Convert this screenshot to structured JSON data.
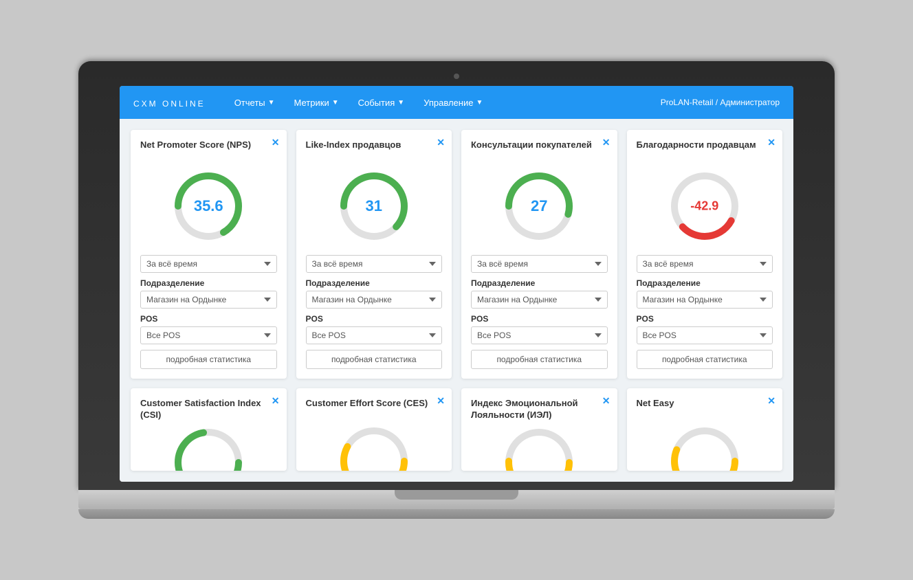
{
  "laptop": {
    "camera_label": "camera"
  },
  "navbar": {
    "brand": "CXM ONLINE",
    "menu_items": [
      {
        "label": "Отчеты",
        "has_arrow": true
      },
      {
        "label": "Метрики",
        "has_arrow": true
      },
      {
        "label": "События",
        "has_arrow": true
      },
      {
        "label": "Управление",
        "has_arrow": true
      }
    ],
    "user": "ProLAN-Retail / Администратор"
  },
  "cards": [
    {
      "title": "Net Promoter Score (NPS)",
      "value": "35.6",
      "value_type": "positive",
      "gauge_color": "#4CAF50",
      "gauge_pct": 68,
      "time_label": "За всё время",
      "dept_label": "Подразделение",
      "dept_value": "Магазин на Ордынке",
      "pos_label": "POS",
      "pos_value": "Все POS",
      "btn_label": "подробная статистика"
    },
    {
      "title": "Like-Index продавцов",
      "value": "31",
      "value_type": "positive",
      "gauge_color": "#4CAF50",
      "gauge_pct": 62,
      "time_label": "За всё время",
      "dept_label": "Подразделение",
      "dept_value": "Магазин на Ордынке",
      "pos_label": "POS",
      "pos_value": "Все POS",
      "btn_label": "подробная статистика"
    },
    {
      "title": "Консультации покупателей",
      "value": "27",
      "value_type": "positive",
      "gauge_color": "#4CAF50",
      "gauge_pct": 54,
      "time_label": "За всё время",
      "dept_label": "Подразделение",
      "dept_value": "Магазин на Ордынке",
      "pos_label": "POS",
      "pos_value": "Все POS",
      "btn_label": "подробная статистика"
    },
    {
      "title": "Благодарности продавцам",
      "value": "-42.9",
      "value_type": "negative",
      "gauge_color": "#e53935",
      "gauge_pct": 30,
      "time_label": "За всё время",
      "dept_label": "Подразделение",
      "dept_value": "Магазин на Ордынке",
      "pos_label": "POS",
      "pos_value": "Все POS",
      "btn_label": "подробная статистика"
    }
  ],
  "bottom_cards": [
    {
      "title": "Customer Satisfaction Index (CSI)",
      "gauge_color": "#4CAF50"
    },
    {
      "title": "Customer Effort Score (CES)",
      "gauge_color": "#FFC107"
    },
    {
      "title": "Индекс Эмоциональной Лояльности (ИЭЛ)",
      "gauge_color": "#FFC107"
    },
    {
      "title": "Net Easy",
      "gauge_color": "#FFC107"
    }
  ],
  "close_symbol": "✕",
  "dropdown_arrow": "▼"
}
